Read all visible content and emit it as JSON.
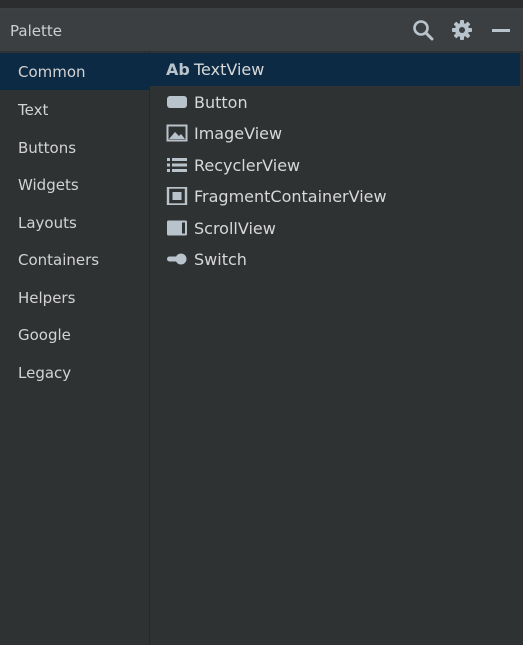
{
  "header": {
    "title": "Palette",
    "icons": [
      "search-icon",
      "gear-icon",
      "minimize-icon"
    ]
  },
  "sidebar": {
    "selected": "Common",
    "items": [
      {
        "label": "Common"
      },
      {
        "label": "Text"
      },
      {
        "label": "Buttons"
      },
      {
        "label": "Widgets"
      },
      {
        "label": "Layouts"
      },
      {
        "label": "Containers"
      },
      {
        "label": "Helpers"
      },
      {
        "label": "Google"
      },
      {
        "label": "Legacy"
      }
    ]
  },
  "components": {
    "selected": "TextView",
    "items": [
      {
        "label": "TextView",
        "icon": "textview-icon",
        "glyph": "Ab"
      },
      {
        "label": "Button",
        "icon": "button-icon"
      },
      {
        "label": "ImageView",
        "icon": "imageview-icon"
      },
      {
        "label": "RecyclerView",
        "icon": "recyclerview-icon"
      },
      {
        "label": "FragmentContainerView",
        "icon": "fragmentcontainerview-icon"
      },
      {
        "label": "ScrollView",
        "icon": "scrollview-icon"
      },
      {
        "label": "Switch",
        "icon": "switch-icon"
      }
    ]
  },
  "colors": {
    "background": "#2f3233",
    "header": "#3b3f41",
    "selection": "#0d2a44",
    "icon": "#b9c3cb",
    "text": "#d6d6d6"
  }
}
